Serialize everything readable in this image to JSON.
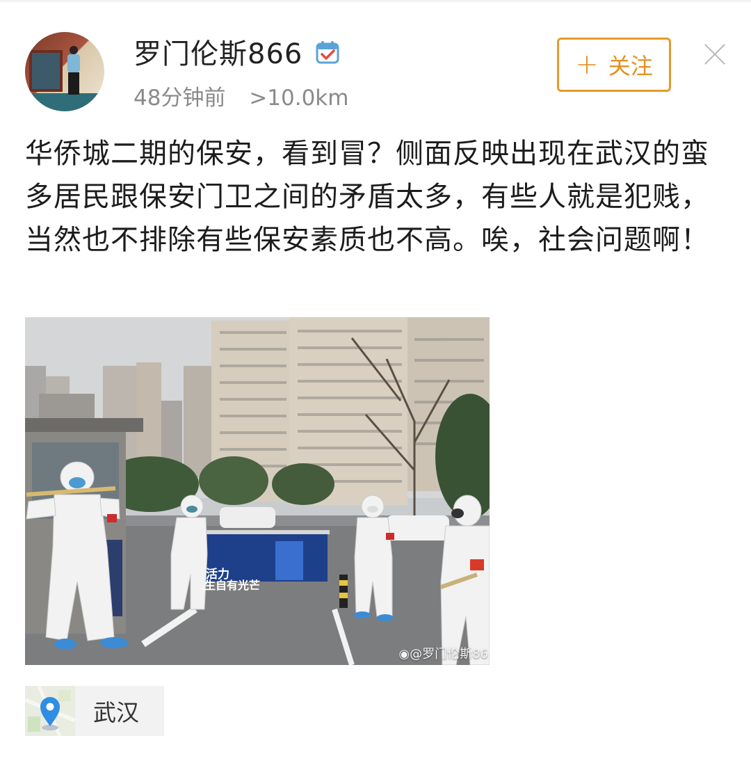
{
  "post": {
    "username": "罗门伦斯866",
    "time_ago": "48分钟前",
    "distance": ">10.0km",
    "follow_label": "关注",
    "text": "华侨城二期的保安，看到冒？侧面反映出现在武汉的蛮多居民跟保安门卫之间的矛盾太多，有些人就是犯贱，当然也不排除有些保安素质也不高。唉，社会问题啊！",
    "location": "武汉"
  },
  "image": {
    "watermark": "@罗门伦斯86",
    "banner_line1": "活力",
    "banner_line2": "生自有光芒"
  },
  "icons": {
    "verified": "calendar-check-icon",
    "follow": "plus-icon",
    "close": "close-icon",
    "location": "map-pin-icon",
    "weibo": "weibo-icon"
  },
  "colors": {
    "follow_accent": "#e59a2a",
    "meta_gray": "#8a8a8a",
    "pin_blue": "#2f8de4"
  }
}
